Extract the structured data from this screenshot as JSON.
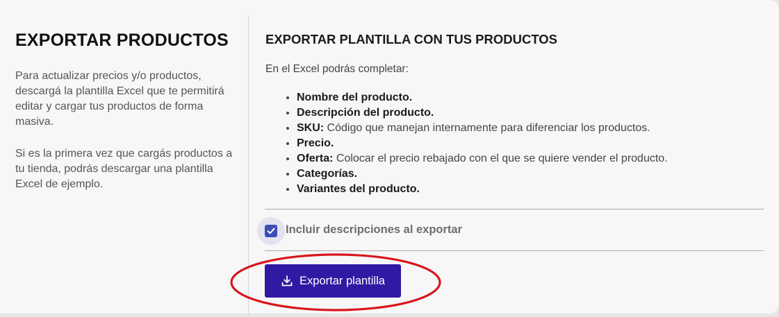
{
  "left_panel": {
    "title": "EXPORTAR PRODUCTOS",
    "paragraph_1": "Para actualizar precios y/o productos, descargá la plantilla Excel que te permitirá editar y cargar tus productos de forma masiva.",
    "paragraph_2": "Si es la primera vez que cargás productos a tu tienda, podrás descargar una plantilla Excel de ejemplo."
  },
  "right_panel": {
    "title": "EXPORTAR PLANTILLA CON TUS PRODUCTOS",
    "intro": "En el Excel podrás completar:",
    "features": [
      {
        "bold": "Nombre del producto.",
        "text": ""
      },
      {
        "bold": "Descripción del producto.",
        "text": ""
      },
      {
        "bold": "SKU:",
        "text": " Código que manejan internamente para diferenciar los productos."
      },
      {
        "bold": "Precio.",
        "text": ""
      },
      {
        "bold": "Oferta:",
        "text": " Colocar el precio rebajado con el que se quiere vender el producto."
      },
      {
        "bold": "Categorías.",
        "text": ""
      },
      {
        "bold": "Variantes del producto.",
        "text": ""
      }
    ],
    "include_descriptions": {
      "label": "Incluir descripciones al exportar",
      "checked": true
    },
    "export_button": {
      "label": "Exportar plantilla",
      "icon": "download-icon"
    }
  },
  "colors": {
    "accent": "#2e1aa3",
    "checkbox": "#3d4db7",
    "highlight": "#d9141c"
  }
}
